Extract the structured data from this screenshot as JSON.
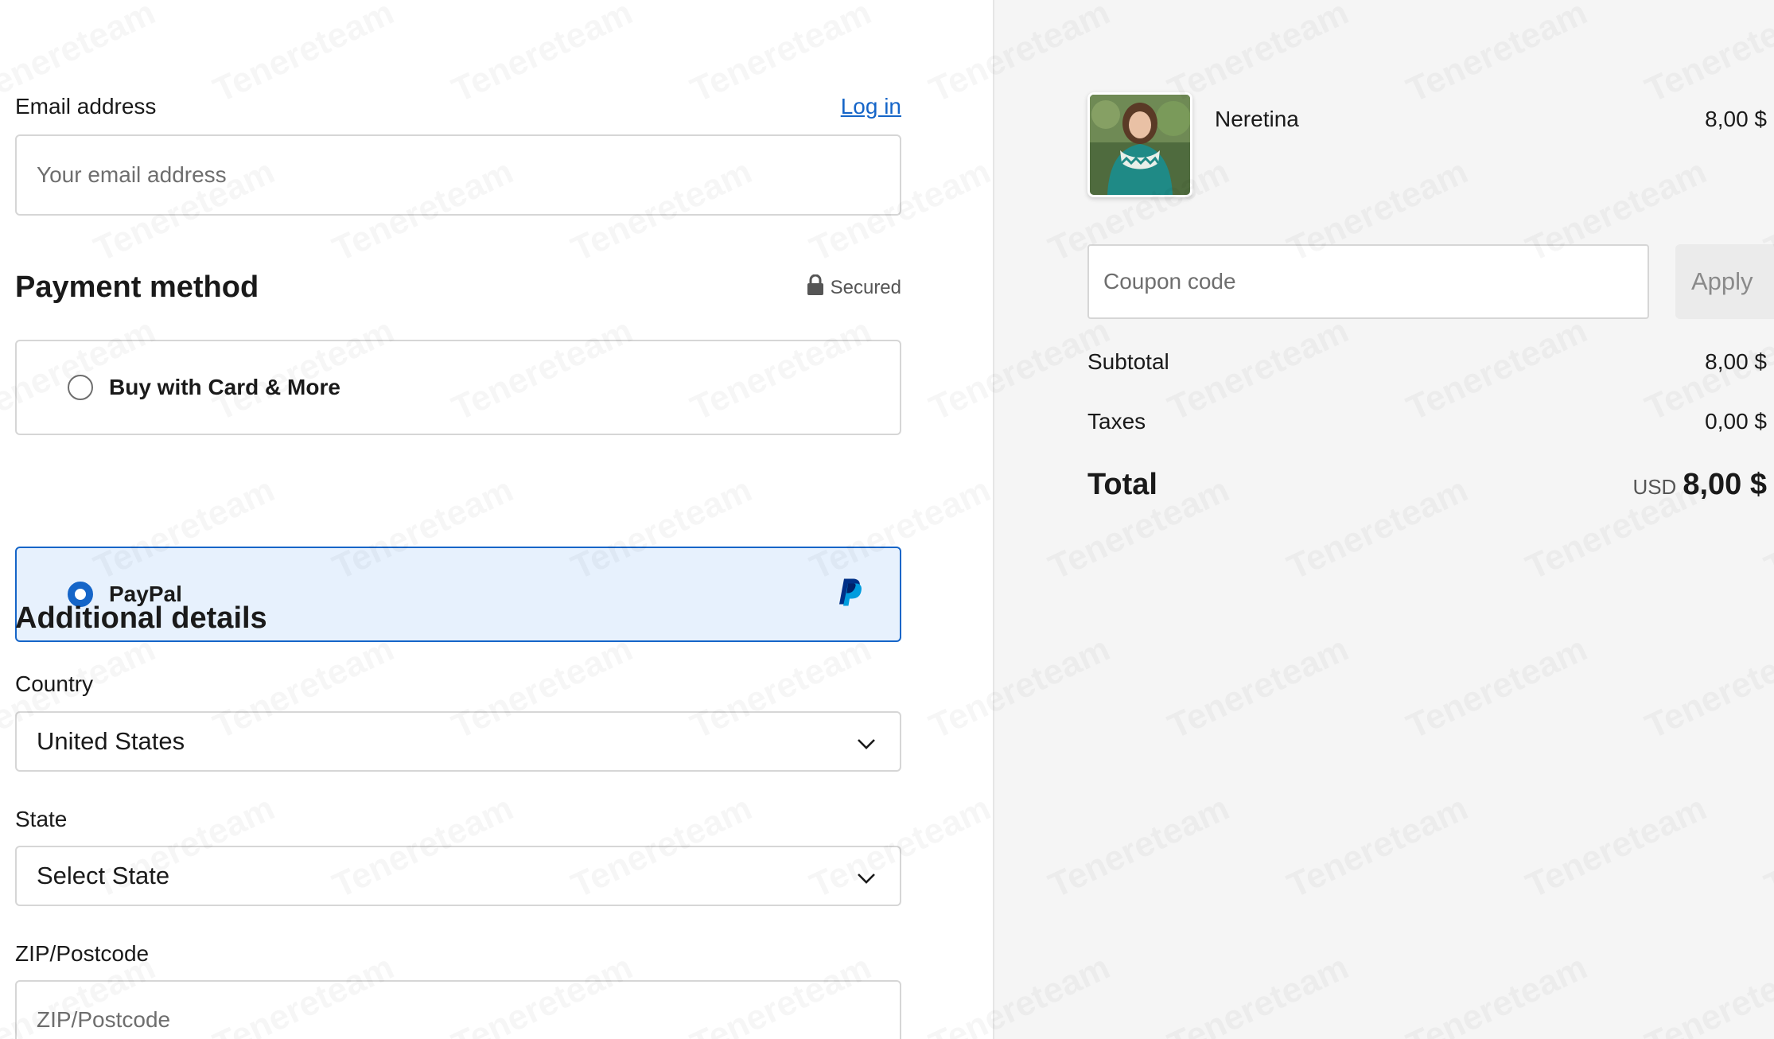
{
  "checkout": {
    "email": {
      "label": "Email address",
      "login_link": "Log in",
      "placeholder": "Your email address",
      "value": ""
    },
    "payment": {
      "title": "Payment method",
      "secured_label": "Secured",
      "options": [
        {
          "label": "Buy with Card & More",
          "selected": false
        },
        {
          "label": "PayPal",
          "selected": true
        }
      ]
    },
    "additional": {
      "title": "Additional details",
      "country": {
        "label": "Country",
        "value": "United States"
      },
      "state": {
        "label": "State",
        "value": "Select State"
      },
      "zip": {
        "label": "ZIP/Postcode",
        "placeholder": "ZIP/Postcode",
        "value": ""
      }
    }
  },
  "summary": {
    "product": {
      "name": "Neretina",
      "price": "8,00 $"
    },
    "coupon": {
      "placeholder": "Coupon code",
      "apply_label": "Apply"
    },
    "subtotal": {
      "label": "Subtotal",
      "value": "8,00 $"
    },
    "taxes": {
      "label": "Taxes",
      "value": "0,00 $"
    },
    "total": {
      "label": "Total",
      "currency": "USD",
      "value": "8,00 $"
    }
  },
  "watermark": {
    "text": "Tenereteam"
  },
  "colors": {
    "accent": "#1565c8",
    "selected_bg": "#e7f1fd",
    "summary_bg": "#f5f5f5",
    "paypal_dark": "#003087",
    "paypal_light": "#009cde"
  }
}
